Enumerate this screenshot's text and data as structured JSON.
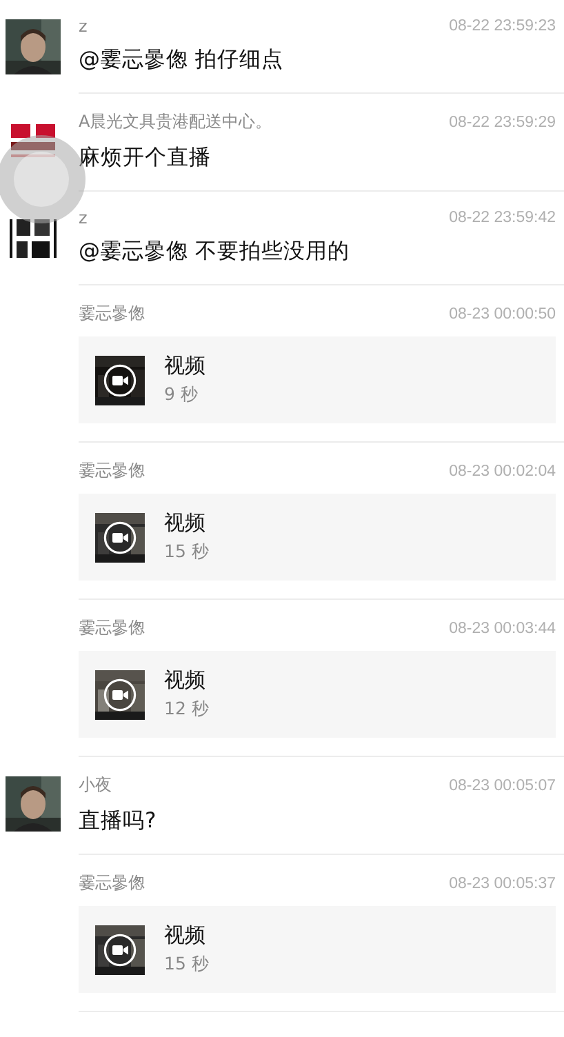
{
  "messages": [
    {
      "kind": "text",
      "sender": "z",
      "time": "08-22 23:59:23",
      "text": "@霎忈曑偬 拍仔细点"
    },
    {
      "kind": "text",
      "sender": "A晨光文具贵港配送中心。",
      "time": "08-22 23:59:29",
      "text": "麻烦开个直播"
    },
    {
      "kind": "text",
      "sender": "z",
      "time": "08-22 23:59:42",
      "text": "@霎忈曑偬 不要拍些没用的"
    },
    {
      "kind": "video",
      "sender": "霎忈曑偬",
      "time": "08-23 00:00:50",
      "title": "视频",
      "duration": "9 秒"
    },
    {
      "kind": "video",
      "sender": "霎忈曑偬",
      "time": "08-23 00:02:04",
      "title": "视频",
      "duration": "15 秒"
    },
    {
      "kind": "video",
      "sender": "霎忈曑偬",
      "time": "08-23 00:03:44",
      "title": "视频",
      "duration": "12 秒"
    },
    {
      "kind": "text",
      "sender": "小夜",
      "time": "08-23 00:05:07",
      "text": "直播吗?"
    },
    {
      "kind": "video",
      "sender": "霎忈曑偬",
      "time": "08-23 00:05:37",
      "title": "视频",
      "duration": "15 秒"
    }
  ]
}
